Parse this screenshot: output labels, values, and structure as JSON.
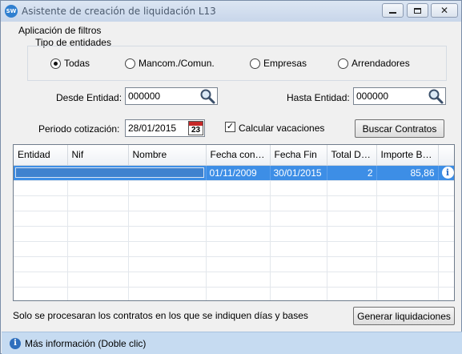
{
  "window": {
    "title": "Asistente de creación de liquidación L13",
    "app_icon": "sw-logo-icon",
    "controls": [
      "minimize",
      "maximize",
      "close"
    ]
  },
  "filters": {
    "section_label": "Aplicación de filtros",
    "entity_type_label": "Tipo de entidades",
    "entity_types": [
      {
        "label": "Todas",
        "selected": true
      },
      {
        "label": "Mancom./Comun.",
        "selected": false
      },
      {
        "label": "Empresas",
        "selected": false
      },
      {
        "label": "Arrendadores",
        "selected": false
      }
    ],
    "desde_label": "Desde Entidad:",
    "desde_value": "000000",
    "hasta_label": "Hasta Entidad:",
    "hasta_value": "000000",
    "periodo_label": "Periodo cotización:",
    "periodo_value": "28/01/2015",
    "calendar_day": "23",
    "vacaciones_label": "Calcular vacaciones",
    "vacaciones_checked": true,
    "search_button": "Buscar Contratos"
  },
  "grid": {
    "columns": [
      "Entidad",
      "Nif",
      "Nombre",
      "Fecha contr...",
      "Fecha Fin",
      "Total Días",
      "Importe Ba..."
    ],
    "rows": [
      {
        "entidad": "",
        "nif": "",
        "nombre": "",
        "fecha_contrato": "01/11/2009",
        "fecha_fin": "30/01/2015",
        "total_dias": "2",
        "importe": "85,86",
        "info": "i"
      }
    ],
    "selected_color": "#3d8ee6"
  },
  "footer": {
    "note": "Solo se procesaran los contratos en los que se indiquen días y bases",
    "generate_button": "Generar liquidaciones"
  },
  "status": {
    "icon": "info-icon",
    "text": "Más información (Doble clic)"
  }
}
